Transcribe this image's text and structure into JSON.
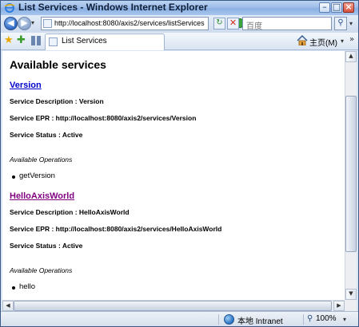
{
  "window": {
    "title": "List Services - Windows Internet Explorer",
    "minimize_glyph": "–",
    "maximize_glyph": "□",
    "close_glyph": "×"
  },
  "navigation": {
    "back_glyph": "◀",
    "forward_glyph": "▶",
    "dropdown_glyph": "▾",
    "address_url": "http://localhost:8080/axis2/services/listServices",
    "go_glyph": "↻",
    "stop_glyph": "✕",
    "search_placeholder": "百度",
    "search_glyph": "⚲"
  },
  "toolbar": {
    "favorites_glyph": "★",
    "add_favorite_glyph": "✚",
    "tab_title": "List Services",
    "home_label": "主页(M)",
    "home_dropdown_glyph": "▾",
    "more_glyph": "»"
  },
  "page": {
    "heading": "Available services",
    "services": [
      {
        "name": "Version",
        "link_state": "normal",
        "description": "Service Description : Version",
        "epr": "Service EPR : http://localhost:8080/axis2/services/Version",
        "status": "Service Status : Active",
        "operations_heading": "Available Operations",
        "operations": [
          "getVersion"
        ]
      },
      {
        "name": "HelloAxisWorld",
        "link_state": "visited",
        "description": "Service Description : HelloAxisWorld",
        "epr": "Service EPR : http://localhost:8080/axis2/services/HelloAxisWorld",
        "status": "Service Status : Active",
        "operations_heading": "Available Operations",
        "operations": [
          "hello"
        ]
      }
    ]
  },
  "scrollbars": {
    "up_glyph": "▲",
    "down_glyph": "▼",
    "left_glyph": "◀",
    "right_glyph": "▶"
  },
  "status_bar": {
    "zone_label": "本地",
    "zone_name": "Intranet",
    "zoom_level": "100%",
    "zoom_glyph": "⚲",
    "zoom_dropdown_glyph": "▾"
  },
  "colors": {
    "link": "#0000cc",
    "visited_link": "#800080",
    "titlebar": "#9fbde8"
  }
}
